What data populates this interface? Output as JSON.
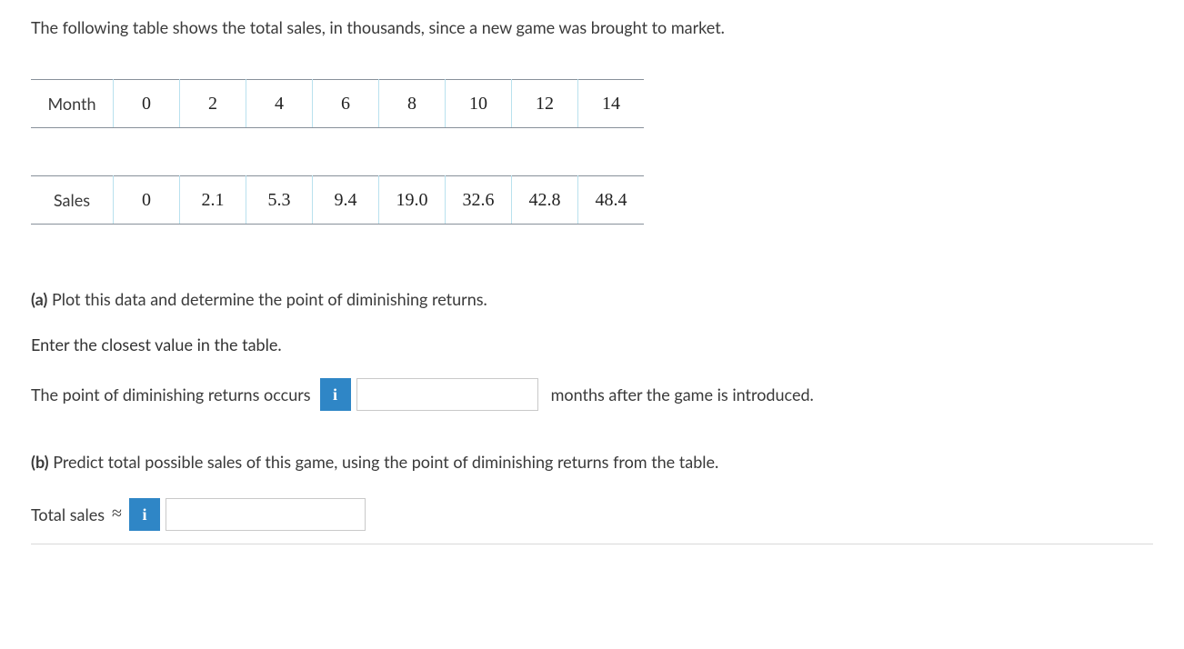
{
  "intro": "The following table shows the total sales, in thousands, since a new game was brought to market.",
  "table": {
    "row1_label": "Month",
    "row1": [
      "0",
      "2",
      "4",
      "6",
      "8",
      "10",
      "12",
      "14"
    ],
    "row2_label": "Sales",
    "row2": [
      "0",
      "2.1",
      "5.3",
      "9.4",
      "19.0",
      "32.6",
      "42.8",
      "48.4"
    ]
  },
  "partA": {
    "label": "(a)",
    "prompt": "Plot this data and determine the point of diminishing returns.",
    "instruction": "Enter the closest value in the table.",
    "before": "The point of diminishing returns occurs",
    "after": "months after the game is introduced."
  },
  "partB": {
    "label": "(b)",
    "prompt": "Predict total possible sales of this game, using the point of diminishing returns from the table.",
    "before": "Total sales",
    "approx": "≈"
  },
  "info_glyph": "i",
  "chart_data": {
    "type": "table",
    "title": "Total sales (thousands) vs. month since launch",
    "xlabel": "Month",
    "ylabel": "Sales (thousands)",
    "x": [
      0,
      2,
      4,
      6,
      8,
      10,
      12,
      14
    ],
    "y": [
      0,
      2.1,
      5.3,
      9.4,
      19.0,
      32.6,
      42.8,
      48.4
    ]
  }
}
